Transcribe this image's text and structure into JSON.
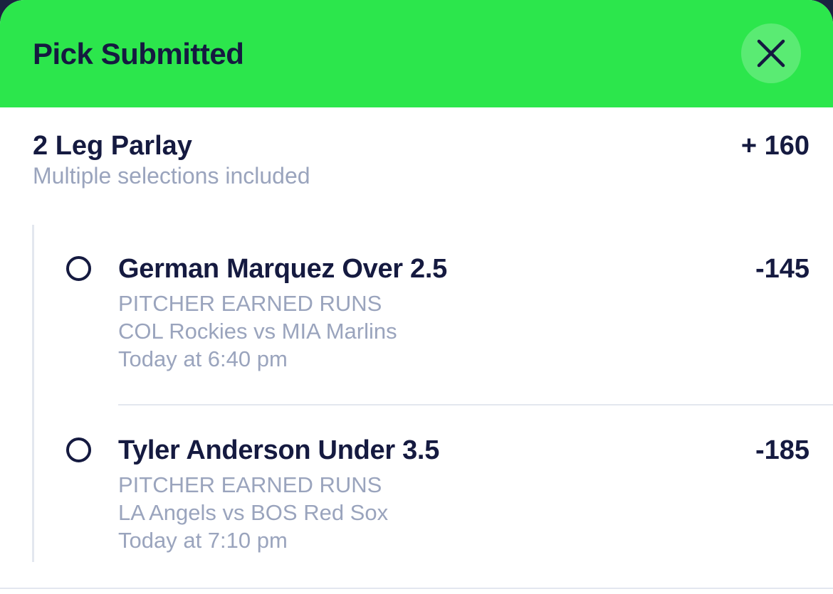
{
  "header": {
    "title": "Pick Submitted",
    "close_icon": "close-icon"
  },
  "parlay": {
    "title": "2 Leg Parlay",
    "subtitle": "Multiple selections included",
    "odds": "+ 160"
  },
  "legs": [
    {
      "title": "German Marquez Over 2.5",
      "odds": "-145",
      "market": "PITCHER EARNED RUNS",
      "matchup": "COL Rockies vs MIA Marlins",
      "time": "Today at 6:40 pm"
    },
    {
      "title": "Tyler Anderson Under 3.5",
      "odds": "-185",
      "market": "PITCHER EARNED RUNS",
      "matchup": "LA Angels vs BOS Red Sox",
      "time": "Today at 7:10 pm"
    }
  ],
  "colors": {
    "header_bg": "#2ce64c",
    "text_primary": "#151a40",
    "text_secondary": "#9aa4bd"
  }
}
